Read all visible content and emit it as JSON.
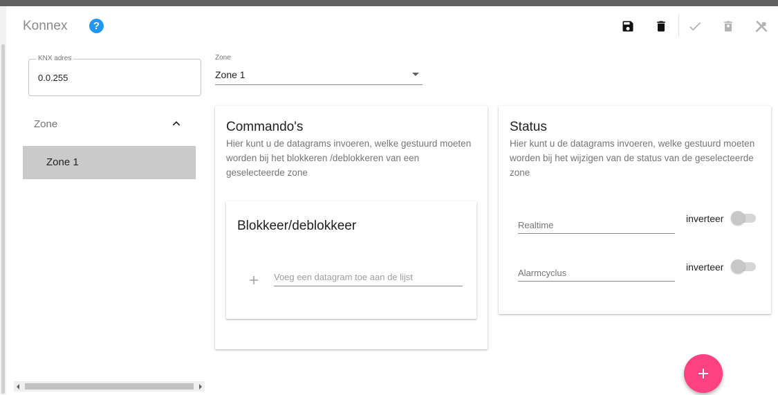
{
  "header": {
    "title": "Konnex",
    "help_glyph": "?"
  },
  "toolbar": {
    "save": "save-icon",
    "delete": "trash-icon",
    "confirm": "check-icon",
    "discard": "delete-x-icon",
    "tools": "tools-icon"
  },
  "knx": {
    "label": "KNX adres",
    "value": "0.0.255"
  },
  "zone_select": {
    "label": "Zone",
    "value": "Zone 1"
  },
  "sidebar": {
    "header": "Zone",
    "items": [
      {
        "label": "Zone 1",
        "selected": true
      }
    ]
  },
  "commands": {
    "title": "Commando's",
    "description": "Hier kunt u de datagrams invoeren, welke gestuurd moeten worden bij het blokkeren /deblokkeren van een geselecteerde zone",
    "sub": {
      "title": "Blokkeer/deblokkeer",
      "add_placeholder": "Voeg een datagram toe aan de lijst"
    }
  },
  "status": {
    "title": "Status",
    "description": "Hier kunt u de datagrams invoeren, welke gestuurd moeten worden bij het wijzigen van de status van de geselecteerde zone",
    "rows": [
      {
        "field": "Realtime",
        "toggle_label": "inverteer",
        "on": false
      },
      {
        "field": "Alarmcyclus",
        "toggle_label": "inverteer",
        "on": false
      }
    ]
  },
  "colors": {
    "accent": "#2196f3",
    "fab": "#ff4081",
    "selected_bg": "#cacaca"
  }
}
